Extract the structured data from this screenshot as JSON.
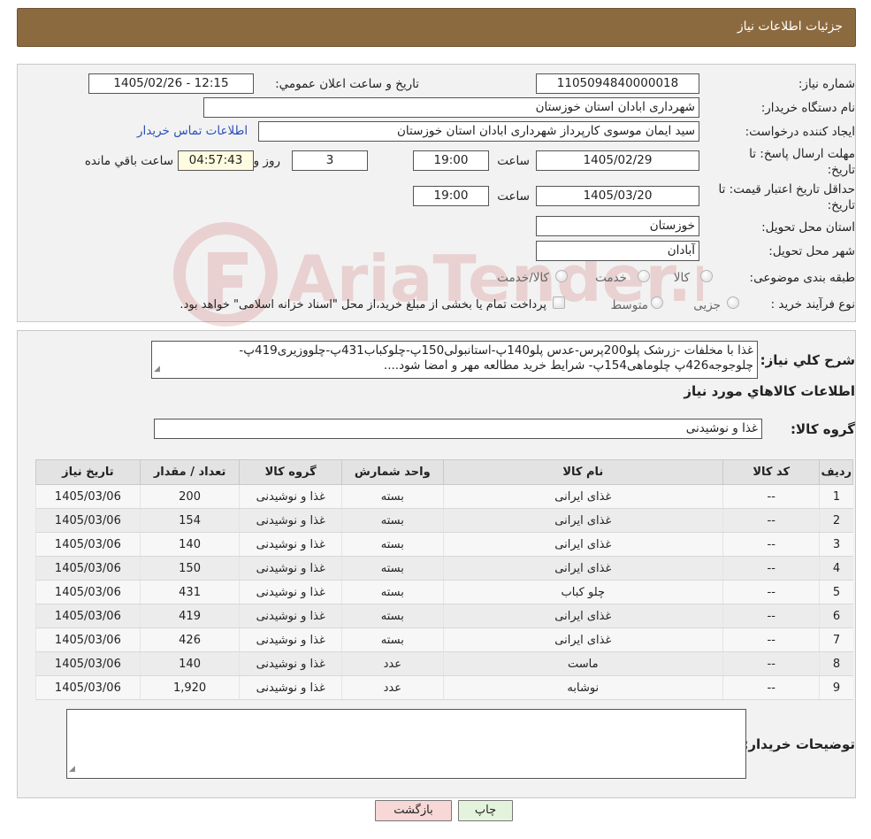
{
  "header": {
    "title": "جزئيات اطلاعات نياز"
  },
  "form": {
    "need_number_label": "شماره نیاز:",
    "need_number": "1105094840000018",
    "announce_label": "تاريخ و ساعت اعلان عمومي:",
    "announce_value": "1405/02/26 - 12:15",
    "buyer_org_label": "نام دستگاه خریدار:",
    "buyer_org": "شهرداری ابادان استان خوزستان",
    "creator_label": "ایجاد کننده درخواست:",
    "creator": "سید ایمان موسوی کارپرداز شهرداری ابادان استان خوزستان",
    "contact_link": "اطلاعات تماس خریدار",
    "deadline_label_1": "مهلت ارسال پاسخ: تا",
    "deadline_label_2": "تاریخ:",
    "deadline_date": "1405/02/29",
    "hour_label": "ساعت",
    "deadline_time": "19:00",
    "days_value": "3",
    "days_label": "روز و",
    "remaining_time": "04:57:43",
    "remaining_label": "ساعت باقي مانده",
    "validity_label_1": "حداقل تاریخ اعتبار قیمت: تا",
    "validity_label_2": "تاریخ:",
    "validity_date": "1405/03/20",
    "validity_time": "19:00",
    "province_label": "استان محل تحویل:",
    "province": "خوزستان",
    "city_label": "شهر محل تحویل:",
    "city": "آبادان",
    "category_label": "طبقه بندی موضوعی:",
    "category_options": [
      "کالا",
      "خدمت",
      "کالا/خدمت"
    ],
    "process_label": "نوع فرآیند خرید :",
    "process_options": [
      "جزیی",
      "متوسط"
    ],
    "process_note": "پرداخت تمام یا بخشی از مبلغ خرید،از محل \"اسناد خزانه اسلامی\" خواهد بود."
  },
  "details": {
    "summary_label": "شرح کلي نياز:",
    "summary_line1": "غذا با مخلفات -زرشک پلو200پرس-عدس پلو140پ-استانبولی150پ-چلوکباب431پ-چلووزیری419پ-",
    "summary_line2": "چلوجوجه426پ چلوماهی154پ- شرایط خرید مطالعه مهر و امضا شود....",
    "goods_info_title": "اطلاعات کالاهاي مورد نياز",
    "goods_group_label": "گروه کالا:",
    "goods_group": "غذا و نوشیدنی"
  },
  "table": {
    "headers": [
      "ردیف",
      "کد کالا",
      "نام کالا",
      "واحد شمارش",
      "گروه کالا",
      "تعداد / مقدار",
      "تاریخ نیاز"
    ],
    "rows": [
      [
        "1",
        "--",
        "غذای ایرانی",
        "بسته",
        "غذا و نوشیدنی",
        "200",
        "1405/03/06"
      ],
      [
        "2",
        "--",
        "غذای ایرانی",
        "بسته",
        "غذا و نوشیدنی",
        "154",
        "1405/03/06"
      ],
      [
        "3",
        "--",
        "غذای ایرانی",
        "بسته",
        "غذا و نوشیدنی",
        "140",
        "1405/03/06"
      ],
      [
        "4",
        "--",
        "غذای ایرانی",
        "بسته",
        "غذا و نوشیدنی",
        "150",
        "1405/03/06"
      ],
      [
        "5",
        "--",
        "چلو کباب",
        "بسته",
        "غذا و نوشیدنی",
        "431",
        "1405/03/06"
      ],
      [
        "6",
        "--",
        "غذای ایرانی",
        "بسته",
        "غذا و نوشیدنی",
        "419",
        "1405/03/06"
      ],
      [
        "7",
        "--",
        "غذای ایرانی",
        "بسته",
        "غذا و نوشیدنی",
        "426",
        "1405/03/06"
      ],
      [
        "8",
        "--",
        "ماست",
        "عدد",
        "غذا و نوشیدنی",
        "140",
        "1405/03/06"
      ],
      [
        "9",
        "--",
        "نوشابه",
        "عدد",
        "غذا و نوشیدنی",
        "1,920",
        "1405/03/06"
      ]
    ]
  },
  "buyer_notes_label": "توضیحات خریدار:",
  "buttons": {
    "print": "چاپ",
    "back": "بازگشت"
  },
  "watermark_text": "AriaTender.neT",
  "colors": {
    "header_bg": "#8c6a3f",
    "panel_bg": "#f2f2f2",
    "link": "#2b4fb8",
    "back_button": "#f8d7d7",
    "print_button": "#e4f4dc"
  }
}
